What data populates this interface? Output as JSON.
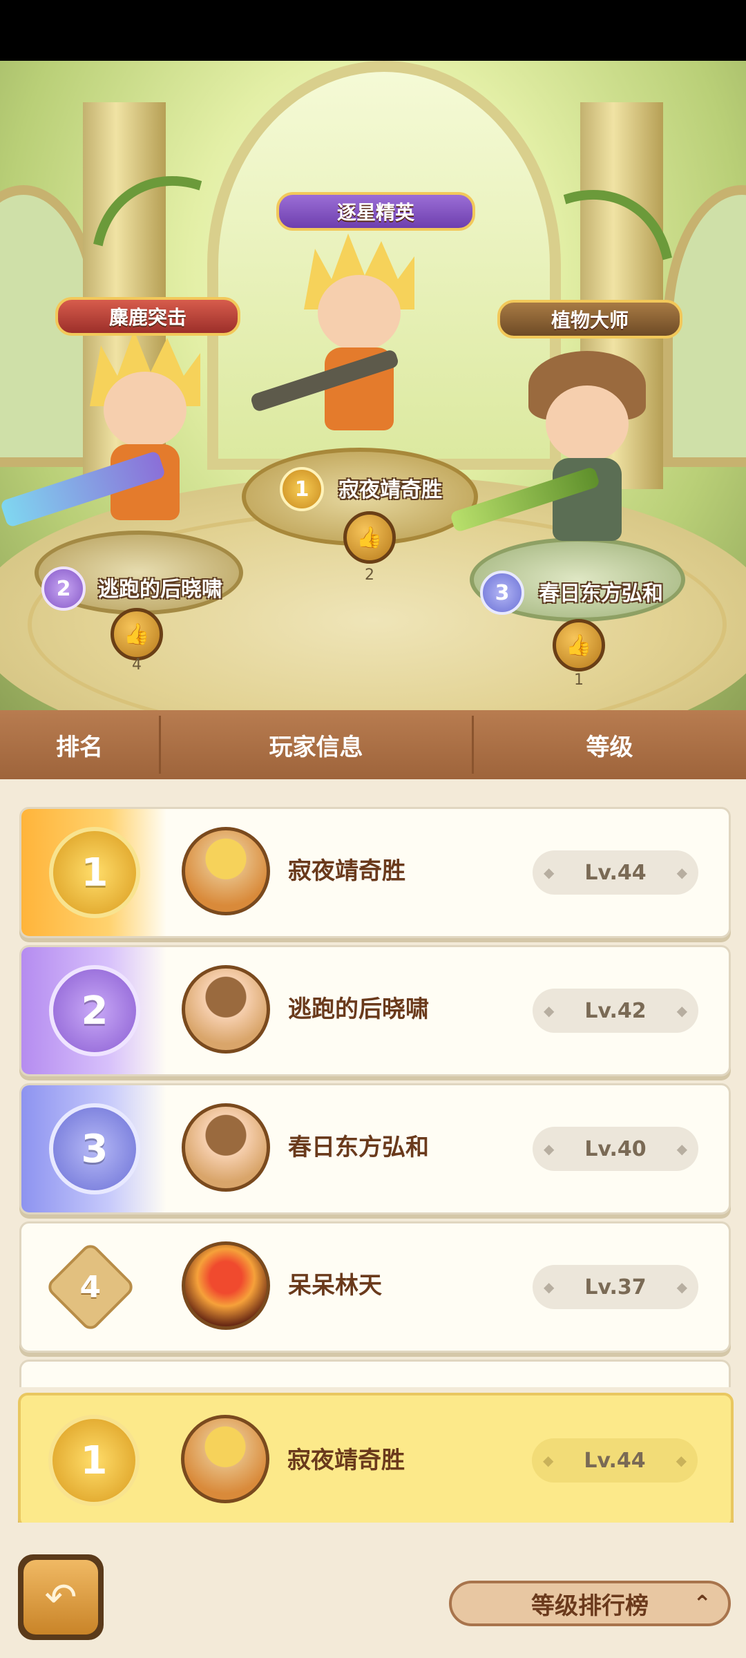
{
  "podium": {
    "first": {
      "title": "逐星精英",
      "name": "寂夜靖奇胜",
      "rank": "1",
      "likes": "2"
    },
    "second": {
      "title": "麋鹿突击",
      "name": "逃跑的后晓啸",
      "rank": "2",
      "likes": "4"
    },
    "third": {
      "title": "植物大师",
      "name": "春日东方弘和",
      "rank": "3",
      "likes": "1"
    }
  },
  "header": {
    "rank": "排名",
    "player_info": "玩家信息",
    "level": "等级"
  },
  "rows": [
    {
      "rank": "1",
      "name": "寂夜靖奇胜",
      "level": "Lv.44"
    },
    {
      "rank": "2",
      "name": "逃跑的后晓啸",
      "level": "Lv.42"
    },
    {
      "rank": "3",
      "name": "春日东方弘和",
      "level": "Lv.40"
    },
    {
      "rank": "4",
      "name": "呆呆林天",
      "level": "Lv.37"
    }
  ],
  "me": {
    "rank": "1",
    "name": "寂夜靖奇胜",
    "level": "Lv.44"
  },
  "footer": {
    "board_label": "等级排行榜",
    "back_icon": "back-arrow-icon",
    "chevron_icon": "chevron-up-icon"
  },
  "colors": {
    "gold": "#f2b43c",
    "purple": "#a57be0",
    "blue": "#7f86e8",
    "panel": "#f3ead8"
  }
}
